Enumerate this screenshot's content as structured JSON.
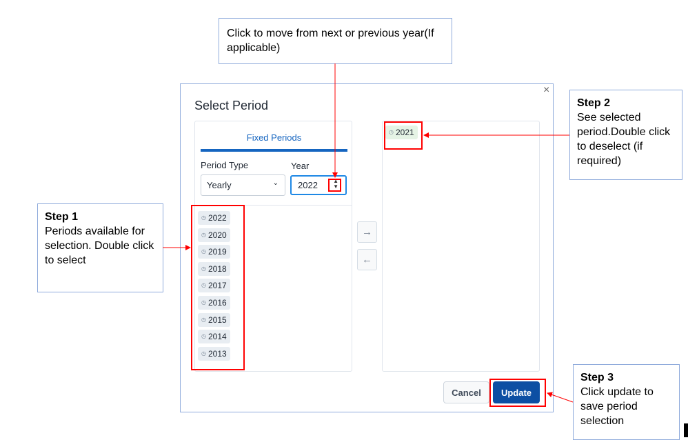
{
  "callouts": {
    "top": "Click to move from next or previous year(If applicable)",
    "step1": {
      "title": "Step 1",
      "text": "Periods available for selection. Double click to select"
    },
    "step2": {
      "title": "Step 2",
      "text": "See selected period.Double click to deselect (if required)"
    },
    "step3": {
      "title": "Step 3",
      "text": "Click update to save period selection"
    }
  },
  "dialog": {
    "title": "Select Period",
    "close": "×",
    "tab": "Fixed Periods",
    "period_type_label": "Period Type",
    "period_type_value": "Yearly",
    "year_label": "Year",
    "year_value": "2022",
    "available": [
      "2022",
      "2020",
      "2019",
      "2018",
      "2017",
      "2016",
      "2015",
      "2014",
      "2013"
    ],
    "selected": [
      "2021"
    ],
    "cancel": "Cancel",
    "update": "Update"
  },
  "colors": {
    "accent": "#1565c0",
    "annotation": "#ff0000"
  }
}
